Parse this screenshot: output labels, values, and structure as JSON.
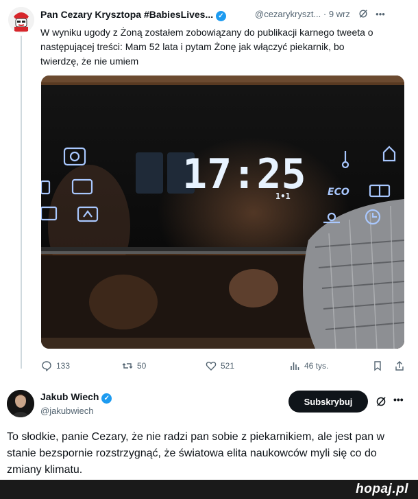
{
  "tweet": {
    "author_name": "Pan Cezary Krysztopa #BabiesLives...",
    "handle": "@cezarykryszt...",
    "time": "· 9 wrz",
    "text": "W wyniku ugody z Żoną zostałem zobowiązany do publikacji karnego tweeta o następującej treści: Mam 52 lata i pytam Żonę jak włączyć piekarnik, bo twierdzę, że nie umiem",
    "photo": {
      "clock": "17:25",
      "eco_label": "ECO",
      "small_label": "1•1"
    },
    "actions": {
      "replies": "133",
      "retweets": "50",
      "likes": "521",
      "views": "46 tys."
    }
  },
  "reply": {
    "author_name": "Jakub Wiech",
    "handle": "@jakubwiech",
    "subscribe_label": "Subskrybuj",
    "text": "To słodkie, panie Cezary, że nie radzi pan sobie z piekarnikiem, ale jest pan w stanie bezspornie rozstrzygnąć, że światowa elita naukowców myli się co do zmiany klimatu."
  },
  "footer": {
    "brand": "hopaj.pl"
  },
  "colors": {
    "verified": "#1d9bf0",
    "text": "#0f1419",
    "secondary": "#536471",
    "button": "#0f1419"
  }
}
